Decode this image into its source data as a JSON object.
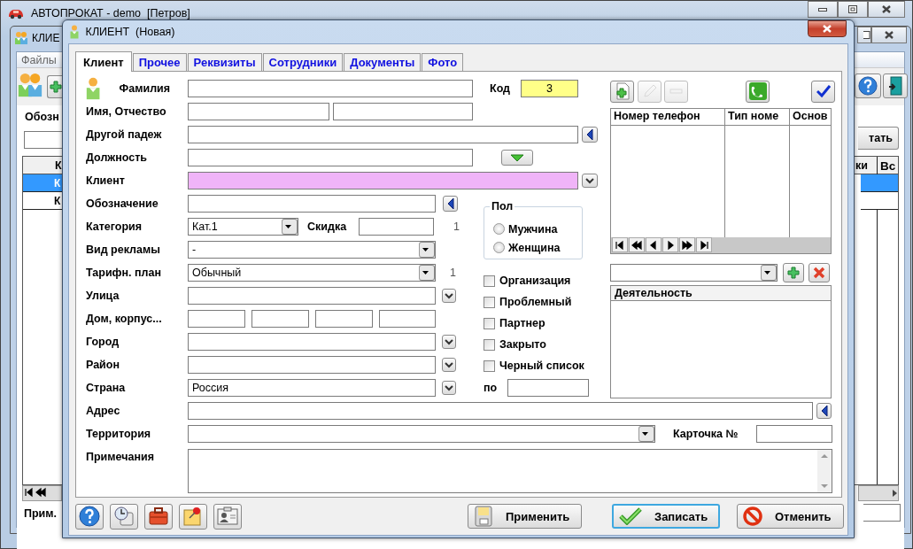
{
  "main_window": {
    "title": "АВТОПРОКАТ - demo  [Петров]"
  },
  "list_window": {
    "title": "КЛИЕ",
    "menu": [
      "Файлы"
    ],
    "filter_label": "Обозн",
    "button": "тать",
    "columns": [
      "К",
      "ки",
      "Вс"
    ],
    "rows": [
      {
        "cells": [
          "К"
        ],
        "selected": true
      },
      {
        "cells": [
          "К"
        ],
        "selected": false
      }
    ],
    "notes_label": "Прим."
  },
  "dialog": {
    "title": "КЛИЕНТ  (Новая)",
    "tabs": [
      {
        "label": "Клиент",
        "selected": true
      },
      {
        "label": "Прочее",
        "selected": false
      },
      {
        "label": "Реквизиты",
        "selected": false
      },
      {
        "label": "Сотрудники",
        "selected": false
      },
      {
        "label": "Документы",
        "selected": false
      },
      {
        "label": "Фото",
        "selected": false
      }
    ],
    "surname": {
      "label": "Фамилия"
    },
    "code": {
      "label": "Код",
      "value": "3",
      "readonly": true
    },
    "first_middle_name": {
      "label": "Имя, Отчество"
    },
    "other_case": {
      "label": "Другой падеж"
    },
    "position": {
      "label": "Должность"
    },
    "client": {
      "label": "Клиент",
      "focused": true
    },
    "designation": {
      "label": "Обозначение"
    },
    "category": {
      "label": "Категория",
      "value": "Кат.1"
    },
    "discount": {
      "label": "Скидка",
      "note": "1"
    },
    "advertising": {
      "label": "Вид рекламы",
      "value": "-"
    },
    "tariff": {
      "label": "Тарифн. план",
      "value": "Обычный",
      "note": "1"
    },
    "street": {
      "label": "Улица"
    },
    "house": {
      "label": "Дом, корпус..."
    },
    "city": {
      "label": "Город"
    },
    "district": {
      "label": "Район"
    },
    "country": {
      "label": "Страна",
      "value": "Россия"
    },
    "gender": {
      "title": "Пол",
      "options": [
        {
          "label": "Мужчина",
          "selected": false
        },
        {
          "label": "Женщина",
          "selected": false
        }
      ]
    },
    "flags": [
      {
        "label": "Организация",
        "checked": false
      },
      {
        "label": "Проблемный",
        "checked": false
      },
      {
        "label": "Партнер",
        "checked": false
      },
      {
        "label": "Закрыто",
        "checked": false
      },
      {
        "label": "Черный список",
        "checked": false
      }
    ],
    "until": {
      "label": "по"
    },
    "phone_toolbar": [
      {
        "kind": "add",
        "disabled": false
      },
      {
        "kind": "edit",
        "disabled": true
      },
      {
        "kind": "remove",
        "disabled": true
      },
      {
        "kind": "call",
        "disabled": false
      },
      {
        "kind": "confirm",
        "disabled": false
      }
    ],
    "phones": {
      "columns": [
        "Номер телефон",
        "Тип номе",
        "Основ"
      ]
    },
    "activity": {
      "header": "Деятельность"
    },
    "address": {
      "label": "Адрес"
    },
    "territory": {
      "label": "Территория"
    },
    "card_number": {
      "label": "Карточка №"
    },
    "notes": {
      "label": "Примечания"
    },
    "actions": [
      {
        "label": "Применить",
        "kind": "apply",
        "default": false
      },
      {
        "label": "Записать",
        "kind": "save",
        "default": true
      },
      {
        "label": "Отменить",
        "kind": "cancel",
        "default": false
      }
    ]
  }
}
